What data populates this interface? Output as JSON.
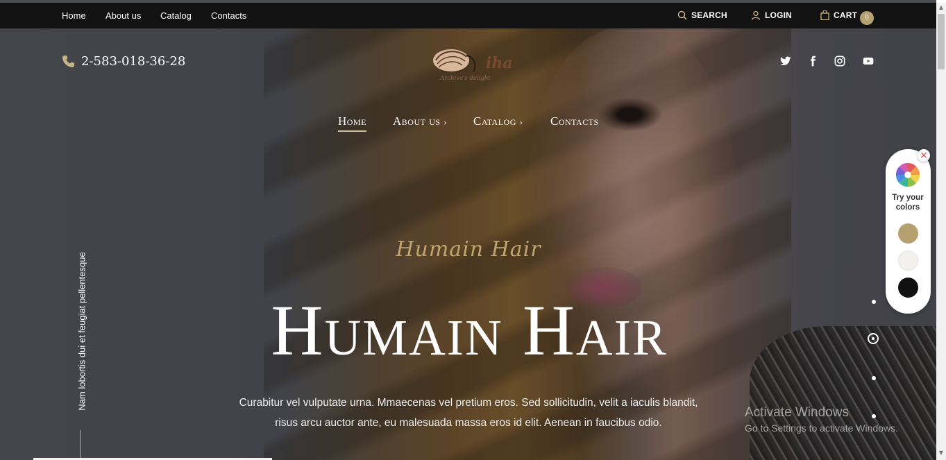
{
  "topbar": {
    "links": [
      "Home",
      "About us",
      "Catalog",
      "Contacts"
    ],
    "search_label": "SEARCH",
    "login_label": "LOGIN",
    "cart_label": "CART",
    "cart_count": "0"
  },
  "header": {
    "phone": "2-583-018-36-28",
    "logo_text": "iha",
    "logo_tagline": "Archive's delight",
    "social_icons": [
      "twitter-icon",
      "facebook-icon",
      "instagram-icon",
      "youtube-icon"
    ]
  },
  "nav": {
    "home": "Home",
    "about": "About us",
    "catalog": "Catalog",
    "contacts": "Contacts",
    "chevron": "›"
  },
  "hero": {
    "script_title": "Humain Hair",
    "title": "Humain Hair",
    "description_line1": "Curabitur vel vulputate urna. Mmaecenas vel pretium eros. Sed sollicitudin, velit a iaculis blandit,",
    "description_line2": "risus arcu auctor ante, eu malesuada massa eros id elit. Aenean in faucibus odio.",
    "vertical_text": "Nam lobortis dui et feugiat pellentesque"
  },
  "color_panel": {
    "label": "Try your colors",
    "swatches": [
      "#b5a070",
      "#f2f1ee",
      "#111111"
    ]
  },
  "watermark": {
    "line1": "Activate Windows",
    "line2": "Go to Settings to activate Windows."
  },
  "colors": {
    "accent": "#b5a070",
    "topbar_bg": "#121212"
  }
}
